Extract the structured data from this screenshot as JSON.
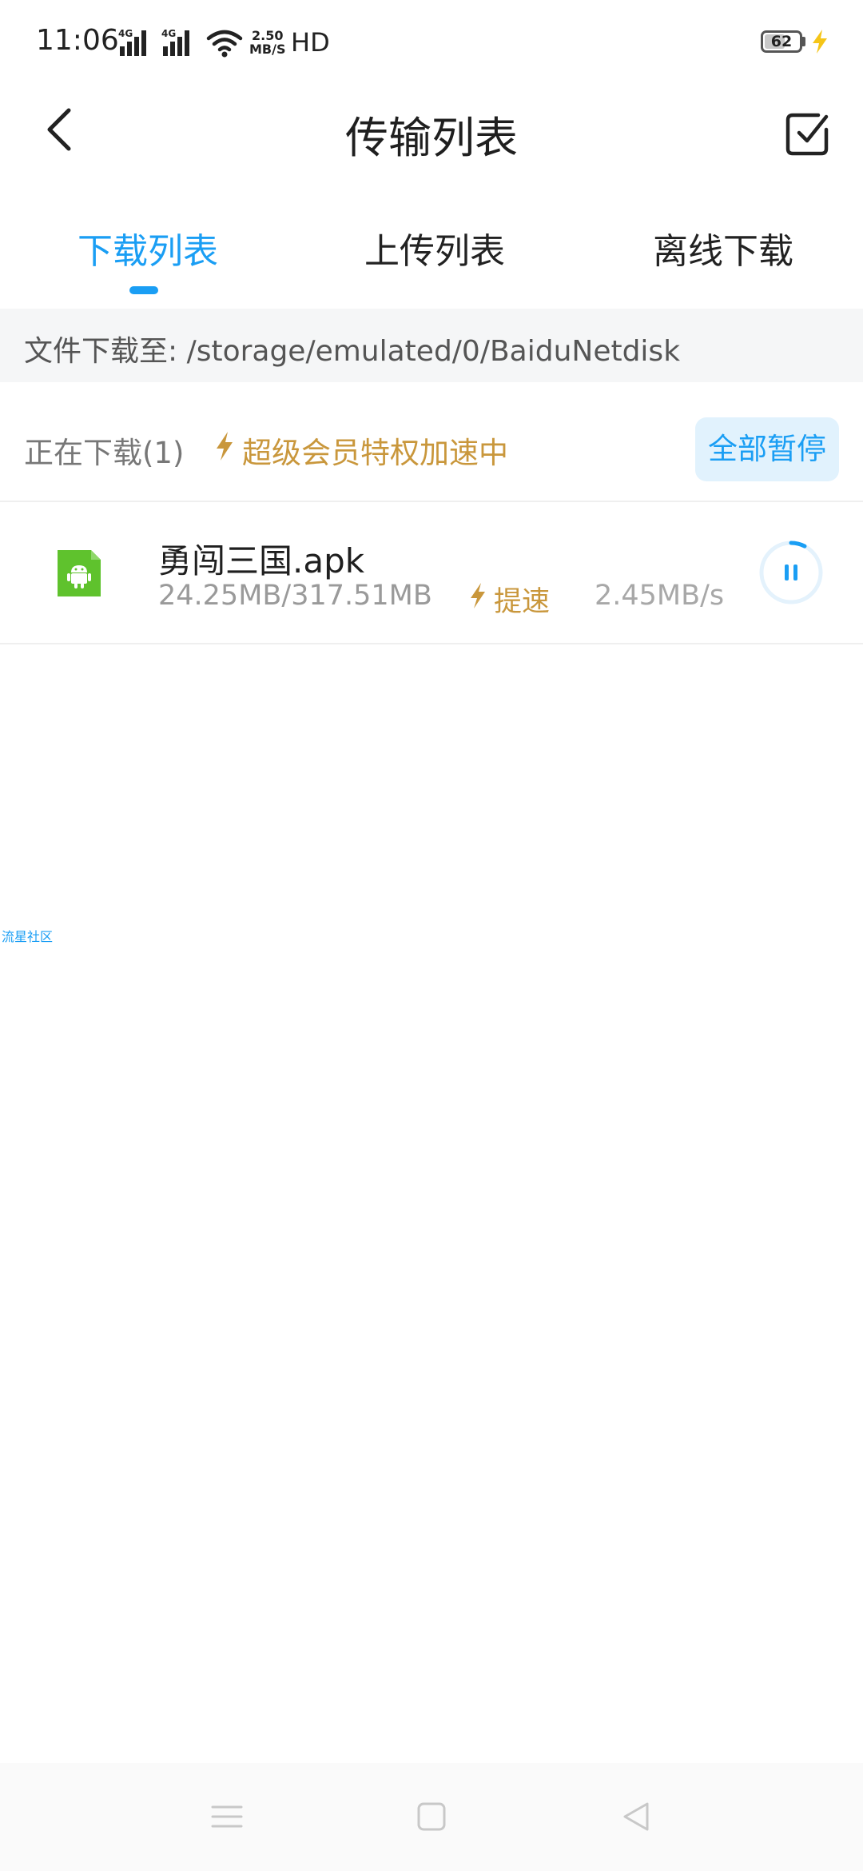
{
  "status_bar": {
    "time": "11:06",
    "signal_1": "4G",
    "signal_2": "4G",
    "net_speed_value": "2.50",
    "net_speed_unit": "MB/S",
    "hd": "HD",
    "battery": "62"
  },
  "header": {
    "title": "传输列表"
  },
  "tabs": [
    {
      "label": "下载列表",
      "active": true
    },
    {
      "label": "上传列表",
      "active": false
    },
    {
      "label": "离线下载",
      "active": false
    }
  ],
  "path": {
    "text": "文件下载至: /storage/emulated/0/BaiduNetdisk"
  },
  "section": {
    "title": "正在下载(1)",
    "vip_text": "超级会员特权加速中",
    "pause_all_label": "全部暂停"
  },
  "downloads": [
    {
      "name": "勇闯三国.apk",
      "progress_text": "24.25MB/317.51MB",
      "speedup_label": "提速",
      "speed": "2.45MB/s",
      "progress_fraction": 0.076
    }
  ],
  "watermark": "流星社区",
  "colors": {
    "accent": "#1a9ef4",
    "vip_gold": "#c9973c",
    "apk_green": "#5fc22d"
  }
}
